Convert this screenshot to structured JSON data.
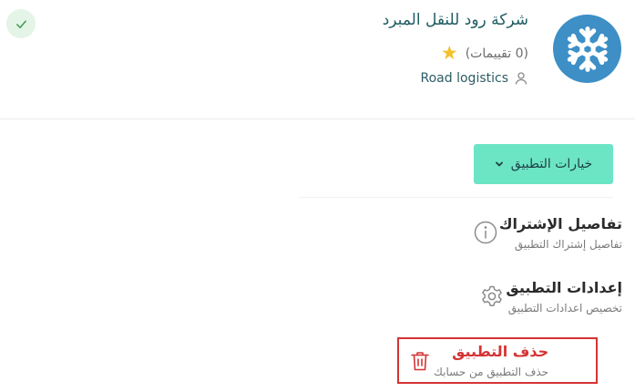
{
  "company": {
    "name": "شركة رود للنقل المبرد",
    "rating_text": "(0 تقييمات)",
    "owner": "Road logistics",
    "logo_icon": "snowflake-icon",
    "logo_color": "#3d8fc6"
  },
  "status": {
    "icon": "check-icon",
    "color": "#e4f4e7"
  },
  "options_button": {
    "label": "خيارات التطبيق",
    "icon": "chevron-down-icon",
    "color": "#6ce5c4"
  },
  "menu": {
    "items": [
      {
        "title": "تفاصيل الإشتراك",
        "subtitle": "تفاصيل إشتراك التطبيق",
        "icon": "info-icon"
      },
      {
        "title": "إعدادات التطبيق",
        "subtitle": "تخصيص اعدادات التطبيق",
        "icon": "gear-icon"
      },
      {
        "title": "حذف التطبيق",
        "subtitle": "حذف التطبيق من حسابك",
        "icon": "trash-icon",
        "color": "#d63333"
      }
    ]
  }
}
